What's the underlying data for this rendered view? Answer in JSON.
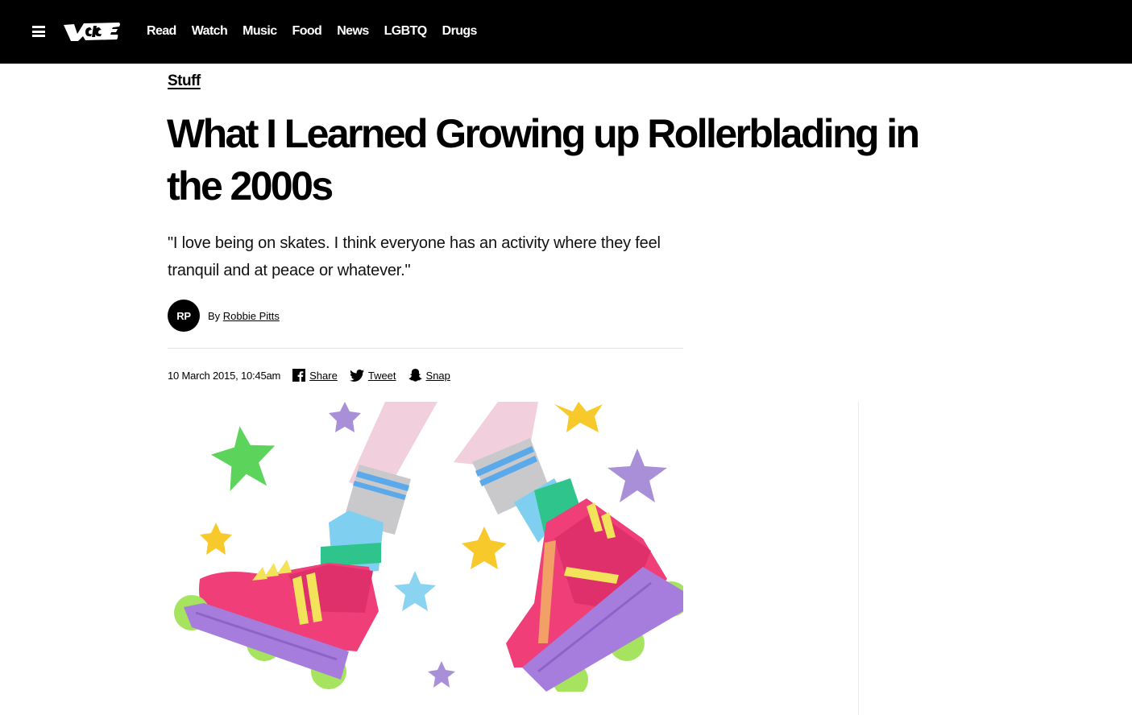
{
  "nav": {
    "menu_icon": "hamburger-menu-icon",
    "logo_text": "VICE",
    "links": [
      "Read",
      "Watch",
      "Music",
      "Food",
      "News",
      "LGBTQ",
      "Drugs"
    ]
  },
  "article": {
    "category": "Stuff",
    "headline": "What I Learned Growing up Rollerblading in the 2000s",
    "dek": "\"I love being on skates. I think everyone has an activity where they feel tranquil and at peace or whatever.\"",
    "author_initials": "RP",
    "by_label": "By",
    "author_name": "Robbie Pitts",
    "date": "10 March 2015, 10:45am",
    "share": {
      "facebook_label": "Share",
      "twitter_label": "Tweet",
      "snapchat_label": "Snap"
    },
    "hero_image": "illustration of legs wearing pink rollerblades with stars"
  },
  "colors": {
    "nav_bg": "#000000",
    "skate_pink": "#ef3e78",
    "wheel_purple": "#a67ddc",
    "wheel_green": "#a6e35e"
  }
}
